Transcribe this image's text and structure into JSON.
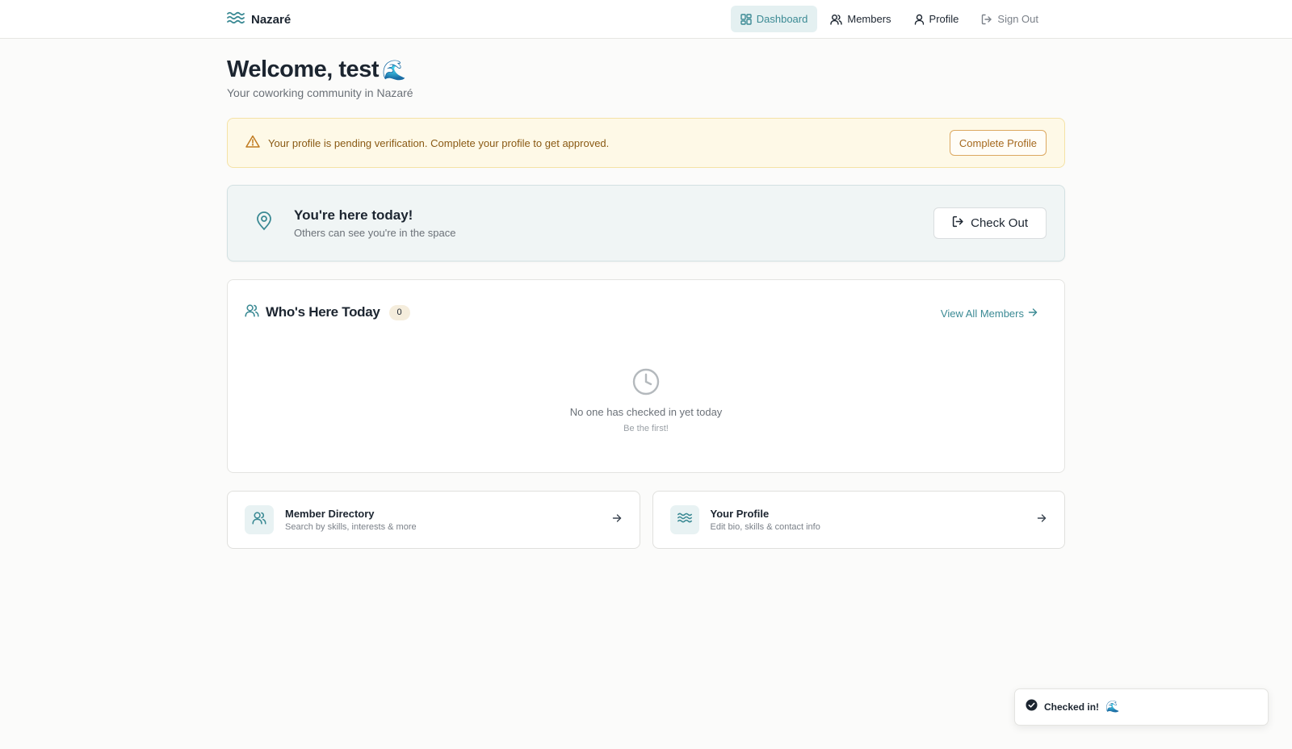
{
  "app": {
    "name": "Nazaré",
    "brand_icon": "waves-icon"
  },
  "nav": {
    "items": [
      {
        "label": "Dashboard",
        "icon": "dashboard-grid-icon",
        "active": true
      },
      {
        "label": "Members",
        "icon": "users-icon"
      },
      {
        "label": "Profile",
        "icon": "user-icon"
      },
      {
        "label": "Sign Out",
        "icon": "sign-out-icon"
      }
    ]
  },
  "welcome": {
    "title": "Welcome, test",
    "emoji": "🌊",
    "subtitle": "Your coworking community in Nazaré"
  },
  "alert": {
    "icon": "warning-triangle-icon",
    "message": "Your profile is pending verification. Complete your profile to get approved.",
    "button_label": "Complete Profile"
  },
  "checkin": {
    "icon": "map-pin-icon",
    "title": "You're here today!",
    "subtitle": "Others can see you're in the space",
    "button_label": "Check Out"
  },
  "who_here": {
    "title": "Who's Here Today",
    "count": "0",
    "view_all_label": "View All Members",
    "empty_title": "No one has checked in yet today",
    "empty_subtitle": "Be the first!"
  },
  "cards": [
    {
      "title": "Member Directory",
      "subtitle": "Search by skills, interests & more",
      "icon": "users-icon"
    },
    {
      "title": "Your Profile",
      "subtitle": "Edit bio, skills & contact info",
      "icon": "waves-icon"
    }
  ],
  "toast": {
    "message": "Checked in!",
    "emoji": "🌊"
  },
  "colors": {
    "accent": "#3b8a94",
    "warning_bg": "#fef9e7",
    "warning_text": "#8a5a14"
  }
}
